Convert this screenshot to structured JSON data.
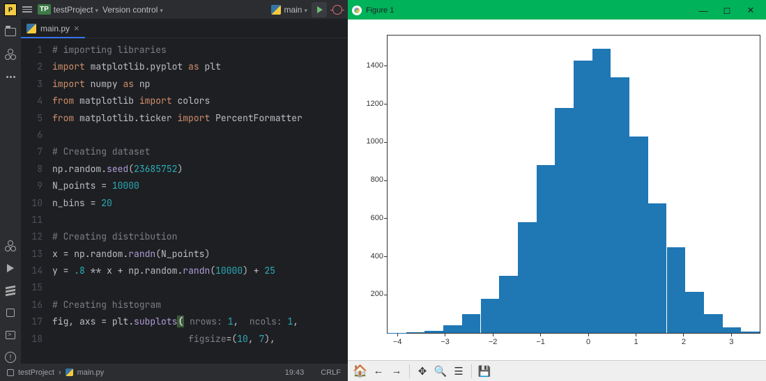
{
  "ide": {
    "project": "testProject",
    "project_badge": "TP",
    "version_control_label": "Version control",
    "run_config": "main",
    "tab": {
      "file": "main.py"
    },
    "breadcrumb": {
      "project": "testProject",
      "file": "main.py"
    },
    "status": {
      "cursor": "19:43",
      "line_sep": "CRLF"
    }
  },
  "code_lines": [
    {
      "n": 1,
      "html": "<span class='tok-comment'># importing libraries</span>"
    },
    {
      "n": 2,
      "html": "<span class='tok-kw'>import</span> <span class='tok-mod'>matplotlib.pyplot</span> <span class='tok-as'>as</span> <span class='tok-mod'>plt</span>"
    },
    {
      "n": 3,
      "html": "<span class='tok-kw'>import</span> <span class='tok-mod'>numpy</span> <span class='tok-as'>as</span> <span class='tok-mod'>np</span>"
    },
    {
      "n": 4,
      "html": "<span class='tok-kw'>from</span> <span class='tok-mod'>matplotlib</span> <span class='tok-kw'>import</span> <span class='tok-mod'>colors</span>"
    },
    {
      "n": 5,
      "html": "<span class='tok-kw'>from</span> <span class='tok-mod'>matplotlib.ticker</span> <span class='tok-kw'>import</span> <span class='tok-mod'>PercentFormatter</span>"
    },
    {
      "n": 6,
      "html": ""
    },
    {
      "n": 7,
      "html": "<span class='tok-comment'># Creating dataset</span>"
    },
    {
      "n": 8,
      "html": "np.random.<span class='tok-call'>seed</span>(<span class='tok-num'>23685752</span>)"
    },
    {
      "n": 9,
      "html": "N_points <span class='tok-op'>=</span> <span class='tok-num'>10000</span>"
    },
    {
      "n": 10,
      "html": "n_bins <span class='tok-op'>=</span> <span class='tok-num'>20</span>"
    },
    {
      "n": 11,
      "html": ""
    },
    {
      "n": 12,
      "html": "<span class='tok-comment'># Creating distribution</span>"
    },
    {
      "n": 13,
      "html": "x <span class='tok-op'>=</span> np.random.<span class='tok-call'>randn</span>(N_points)"
    },
    {
      "n": 14,
      "html": "y <span class='tok-op'>=</span> <span class='tok-num'>.8</span> <span class='tok-op'>**</span> x <span class='tok-op'>+</span> np.random.<span class='tok-call'>randn</span>(<span class='tok-num'>10000</span>) <span class='tok-op'>+</span> <span class='tok-num'>25</span>"
    },
    {
      "n": 15,
      "html": ""
    },
    {
      "n": 16,
      "html": "<span class='tok-comment'># Creating histogram</span>"
    },
    {
      "n": 17,
      "html": "fig, axs <span class='tok-op'>=</span> plt.<span class='tok-call'>subplots</span><span class='paren-hl'>(</span> <span class='tok-hint'>nrows:</span> <span class='tok-num'>1</span>,  <span class='tok-hint'>ncols:</span> <span class='tok-num'>1</span>,"
    },
    {
      "n": 18,
      "html": "                         <span class='tok-hint'>figsize</span>=(<span class='tok-num'>10</span>, <span class='tok-num'>7</span>),"
    }
  ],
  "figure": {
    "title": "Figure 1"
  },
  "chart_data": {
    "type": "bar",
    "subtype": "histogram",
    "xlim": [
      -4.2,
      3.6
    ],
    "ylim": [
      0,
      1560
    ],
    "yticks": [
      200,
      400,
      600,
      800,
      1000,
      1200,
      1400
    ],
    "xticks": [
      -4,
      -3,
      -2,
      -1,
      0,
      1,
      2,
      3
    ],
    "bin_edges": [
      -4.2,
      -3.81,
      -3.42,
      -3.03,
      -2.64,
      -2.25,
      -1.86,
      -1.47,
      -1.08,
      -0.69,
      -0.3,
      0.09,
      0.48,
      0.87,
      1.26,
      1.65,
      2.04,
      2.43,
      2.82,
      3.21,
      3.6
    ],
    "counts": [
      1,
      4,
      12,
      40,
      100,
      180,
      300,
      580,
      880,
      1180,
      1430,
      1490,
      1340,
      1030,
      680,
      450,
      215,
      100,
      30,
      8
    ],
    "bar_color": "#1f77b4"
  },
  "mpl_toolbar": {
    "home": "home",
    "back": "back",
    "forward": "forward",
    "pan": "pan",
    "zoom": "zoom",
    "configure": "configure",
    "save": "save"
  }
}
